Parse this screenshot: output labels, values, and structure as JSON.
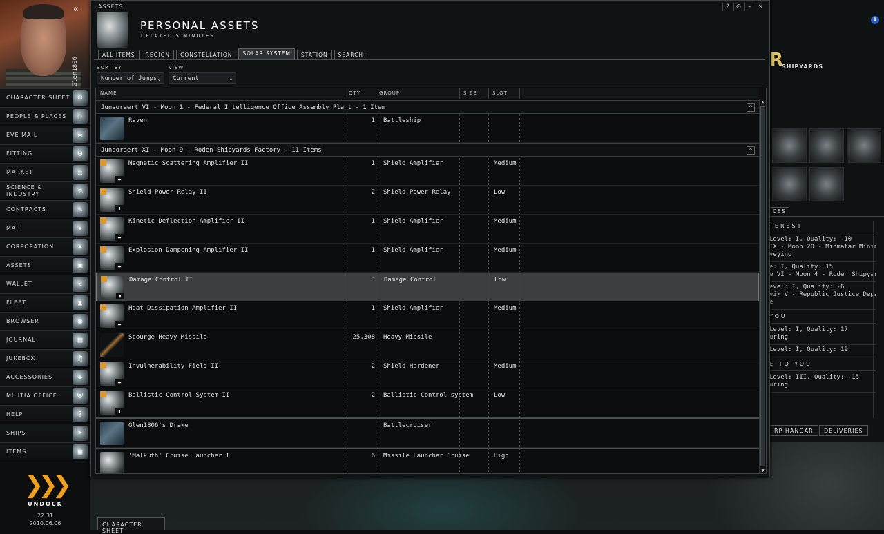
{
  "neocom": {
    "character_name": "Glen1806",
    "items": [
      {
        "label": "CHARACTER SHEET",
        "icon": "character-sheet-icon",
        "glyph": "☺"
      },
      {
        "label": "PEOPLE & PLACES",
        "icon": "people-places-icon",
        "glyph": "⚐"
      },
      {
        "label": "EVE MAIL",
        "icon": "mail-icon",
        "glyph": "✉"
      },
      {
        "label": "FITTING",
        "icon": "fitting-icon",
        "glyph": "⚙"
      },
      {
        "label": "MARKET",
        "icon": "market-icon",
        "glyph": "⚖"
      },
      {
        "label": "SCIENCE & INDUSTRY",
        "icon": "science-industry-icon",
        "glyph": "⚗"
      },
      {
        "label": "CONTRACTS",
        "icon": "contracts-icon",
        "glyph": "✎"
      },
      {
        "label": "MAP",
        "icon": "map-icon",
        "glyph": "✦"
      },
      {
        "label": "CORPORATION",
        "icon": "corporation-icon",
        "glyph": "✶"
      },
      {
        "label": "ASSETS",
        "icon": "assets-icon",
        "glyph": "▣"
      },
      {
        "label": "WALLET",
        "icon": "wallet-icon",
        "glyph": "¤"
      },
      {
        "label": "FLEET",
        "icon": "fleet-icon",
        "glyph": "▲"
      },
      {
        "label": "BROWSER",
        "icon": "browser-icon",
        "glyph": "◉"
      },
      {
        "label": "JOURNAL",
        "icon": "journal-icon",
        "glyph": "▤"
      },
      {
        "label": "JUKEBOX",
        "icon": "jukebox-icon",
        "glyph": "♫"
      },
      {
        "label": "ACCESSORIES",
        "icon": "accessories-icon",
        "glyph": "✚"
      },
      {
        "label": "MILITIA OFFICE",
        "icon": "militia-office-icon",
        "glyph": "⛨"
      },
      {
        "label": "HELP",
        "icon": "help-icon",
        "glyph": "?"
      },
      {
        "label": "SHIPS",
        "icon": "ships-icon",
        "glyph": "➤"
      },
      {
        "label": "ITEMS",
        "icon": "items-icon",
        "glyph": "▦"
      }
    ],
    "undock_label": "UNDOCK",
    "time": "22:31",
    "date": "2010.06.06"
  },
  "bottom_tab": "CHARACTER SHEET",
  "window": {
    "caption": "ASSETS",
    "title": "PERSONAL ASSETS",
    "subtitle": "DELAYED 5 MINUTES",
    "buttons": [
      "?",
      "⊙",
      "–",
      "×"
    ],
    "tabs": [
      "ALL ITEMS",
      "REGION",
      "CONSTELLATION",
      "SOLAR SYSTEM",
      "STATION",
      "SEARCH"
    ],
    "active_tab": "SOLAR SYSTEM",
    "sort_by_label": "SORT BY",
    "sort_by_value": "Number of Jumps",
    "view_label": "VIEW",
    "view_value": "Current",
    "columns": [
      "NAME",
      "QTY",
      "GROUP",
      "SIZE",
      "SLOT"
    ]
  },
  "groups": [
    {
      "title": "Junsoraert VI - Moon 1 - Federal Intelligence Office Assembly Plant - 1 Item",
      "rows": [
        {
          "name": "Raven",
          "qty": "1",
          "group": "Battleship",
          "slot": "",
          "thumb": "ship"
        }
      ]
    },
    {
      "title": "Junsoraert XI - Moon 9 - Roden Shipyards Factory - 11 Items",
      "rows": [
        {
          "name": "Magnetic Scattering Amplifier II",
          "qty": "1",
          "group": "Shield Amplifier",
          "slot": "Medium",
          "thumb": "mod"
        },
        {
          "name": "Shield Power Relay II",
          "qty": "2",
          "group": "Shield Power Relay",
          "slot": "Low",
          "thumb": "mod"
        },
        {
          "name": "Kinetic Deflection Amplifier II",
          "qty": "1",
          "group": "Shield Amplifier",
          "slot": "Medium",
          "thumb": "mod"
        },
        {
          "name": "Explosion Dampening Amplifier II",
          "qty": "1",
          "group": "Shield Amplifier",
          "slot": "Medium",
          "thumb": "mod"
        },
        {
          "name": "Damage Control II",
          "qty": "1",
          "group": "Damage Control",
          "slot": "Low",
          "thumb": "mod",
          "selected": true
        },
        {
          "name": "Heat Dissipation Amplifier II",
          "qty": "1",
          "group": "Shield Amplifier",
          "slot": "Medium",
          "thumb": "mod"
        },
        {
          "name": "Scourge Heavy Missile",
          "qty": "25,308",
          "group": "Heavy Missile",
          "slot": "",
          "thumb": "missile"
        },
        {
          "name": "Invulnerability Field II",
          "qty": "2",
          "group": "Shield Hardener",
          "slot": "Medium",
          "thumb": "mod"
        },
        {
          "name": "Ballistic Control System II",
          "qty": "2",
          "group": "Ballistic Control system",
          "slot": "Low",
          "thumb": "mod"
        },
        {
          "name": "Glen1806's Drake",
          "qty": "",
          "group": "Battlecruiser",
          "slot": "",
          "thumb": "ship",
          "sep_before": true
        },
        {
          "name": "'Malkuth' Cruise Launcher I",
          "qty": "6",
          "group": "Missile Launcher Cruise",
          "slot": "High",
          "thumb": "launcher",
          "sep_before": true
        }
      ]
    }
  ],
  "station": {
    "corp_name": "SHIPYARDS",
    "tab_label": "CES",
    "agent_sections": [
      {
        "header": "TEREST",
        "entries": [
          [
            "Level: I, Quality: -10",
            "IX - Moon 20 - Minmatar Mining",
            "veying"
          ],
          [
            "e: I, Quality: 15",
            "e VI - Moon 4 - Roden Shipyard"
          ],
          [
            "evel: I, Quality: -6",
            "vik V - Republic Justice Departm",
            "e"
          ]
        ]
      },
      {
        "header": "YOU",
        "entries": [
          [
            "Level: I, Quality: 17",
            "uring"
          ],
          [
            "Level: I, Quality: 19"
          ]
        ]
      },
      {
        "header": "E TO YOU",
        "entries": [
          [
            "Level: III, Quality: -15",
            "uring"
          ]
        ]
      }
    ],
    "footer_buttons": [
      "RP HANGAR",
      "DELIVERIES"
    ]
  },
  "colors": {
    "accent": "#f0a020",
    "selected_row": "#3c3f41",
    "info": "#2a5fc0"
  }
}
